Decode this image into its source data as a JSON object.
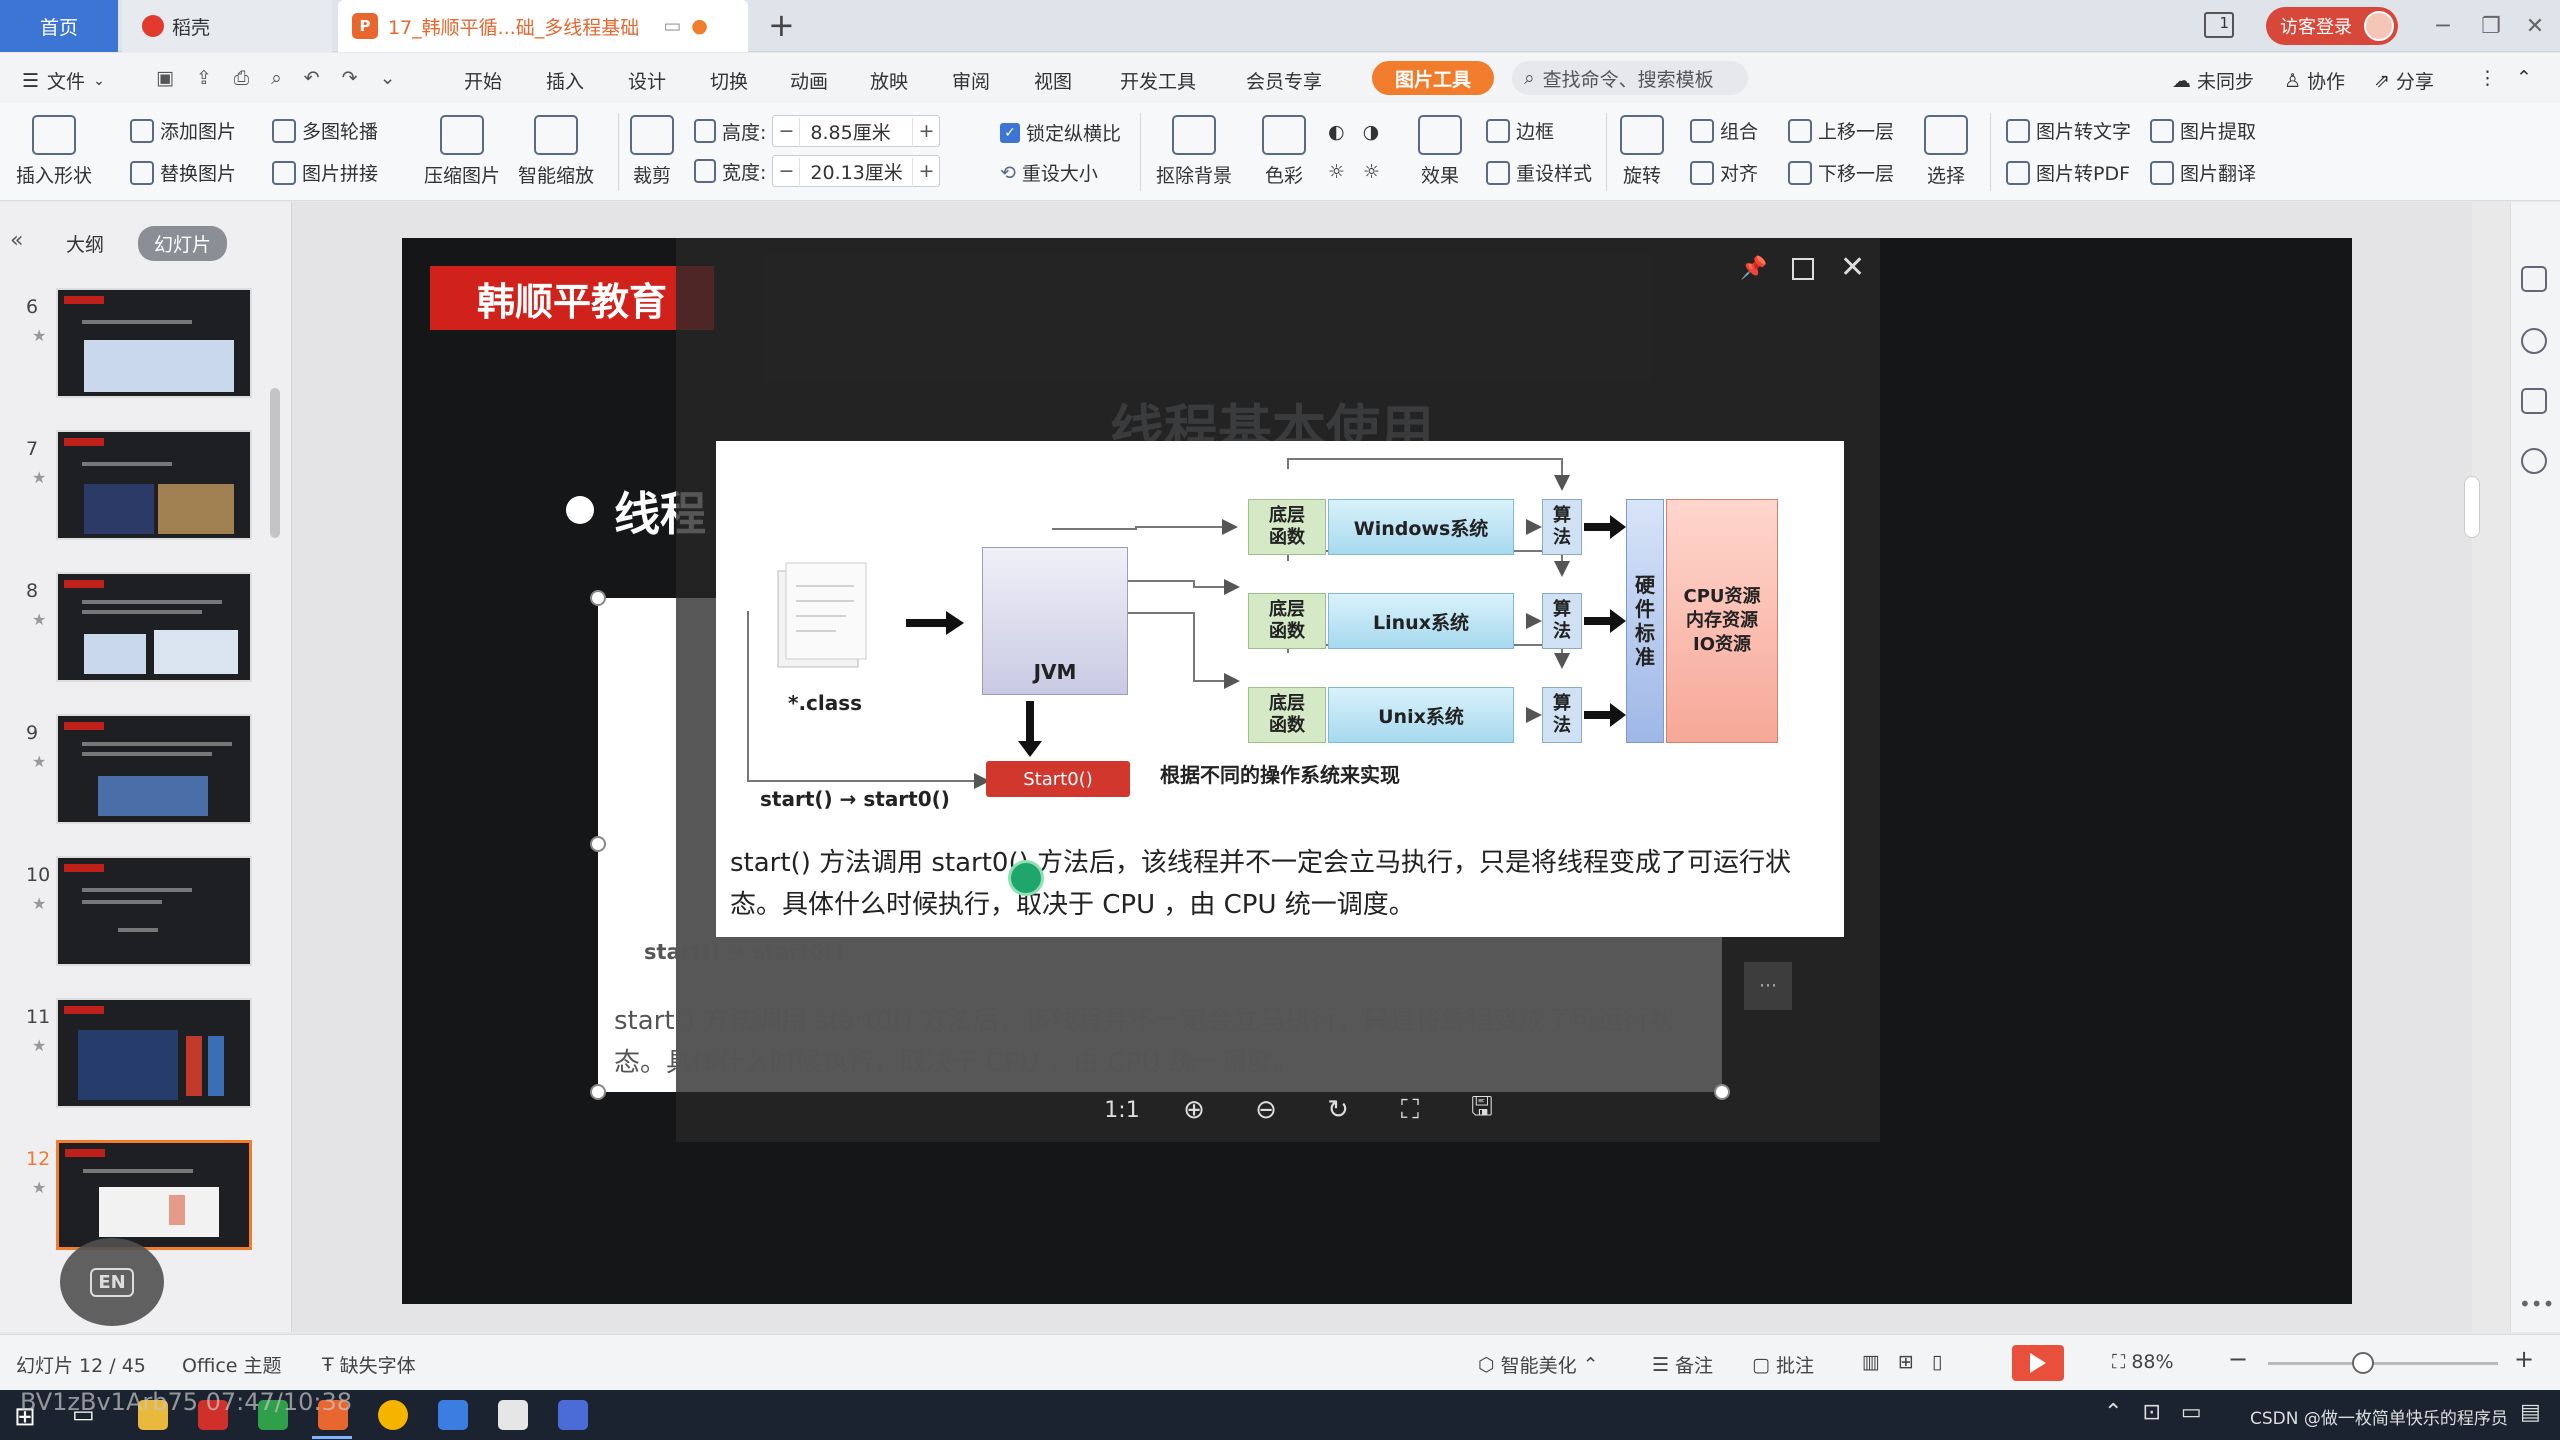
{
  "titlebar": {
    "tab_home": "首页",
    "tab_daoke": "稻壳",
    "tab_doc": "17_韩顺平循...础_多线程基础",
    "window_badge": "1",
    "login": "访客登录"
  },
  "menubar": {
    "file": "文件",
    "items": [
      "开始",
      "插入",
      "设计",
      "切换",
      "动画",
      "放映",
      "审阅",
      "视图",
      "开发工具",
      "会员专享"
    ],
    "picture_tools": "图片工具",
    "search_placeholder": "查找命令、搜索模板",
    "right": [
      "未同步",
      "协作",
      "分享"
    ]
  },
  "ribbon": {
    "insert_shape": "插入形状",
    "add_picture": "添加图片",
    "replace_picture": "替换图片",
    "multi_carousel": "多图轮播",
    "picture_stitch": "图片拼接",
    "compress": "压缩图片",
    "smart_zoom": "智能缩放",
    "crop": "裁剪",
    "height_label": "高度:",
    "height_value": "8.85厘米",
    "width_label": "宽度:",
    "width_value": "20.13厘米",
    "lock_ratio": "锁定纵横比",
    "reset_size": "重设大小",
    "remove_bg": "抠除背景",
    "color": "色彩",
    "effects": "效果",
    "border": "边框",
    "reset_style": "重设样式",
    "rotate": "旋转",
    "group": "组合",
    "align": "对齐",
    "bring_forward": "上移一层",
    "send_backward": "下移一层",
    "select": "选择",
    "pic_to_text": "图片转文字",
    "pic_to_pdf": "图片转PDF",
    "pic_extract": "图片提取",
    "pic_translate": "图片翻译"
  },
  "leftpanel": {
    "tab_outline": "大纲",
    "tab_slides": "幻灯片",
    "slides": [
      "6",
      "7",
      "8",
      "9",
      "10",
      "11",
      "12"
    ],
    "active_slide": "12",
    "en_badge": "EN"
  },
  "slide": {
    "logo": "韩顺平教育",
    "title": "线程基本使用",
    "bullet": "线程"
  },
  "diagram": {
    "class_label": "*.class",
    "jvm_label": "JVM",
    "start0_label": "Start0()",
    "start_caption": "start() → start0()",
    "os_caption": "根据不同的操作系统来实现",
    "low_level": "底层\n函数",
    "systems": [
      "Windows系统",
      "Linux系统",
      "Unix系统"
    ],
    "algo": "算\n法",
    "hw": "硬件标准",
    "resources": "CPU资源\n内存资源\nIO资源"
  },
  "popup_text": "start() 方法调用 start0() 方法后，该线程并不一定会立马执行，只是将线程变成了可运行状态。具体什么时候执行，取决于 CPU ，由 CPU 统一调度。",
  "bg_text": "start() 方法调用 start0() 方法后，该线程并不一定会立马执行，只是将线程变成了可运行状态。具体什么时候执行，取决于 CPU ，由 CPU 统一调度。",
  "bg_caption": "start() → start0()",
  "viewer_toolbar": {
    "one_to_one": "1:1"
  },
  "statusbar": {
    "slide_count": "幻灯片 12 / 45",
    "theme": "Office 主题",
    "missing_font": "缺失字体",
    "smart_beautify": "智能美化",
    "notes": "备注",
    "comments": "批注",
    "zoom": "88%"
  },
  "taskbar": {
    "tray_text": "CSDN @做一枚简单快乐的程序员"
  },
  "watermark": "BV1zBv1Arb75 07:47/10:38"
}
